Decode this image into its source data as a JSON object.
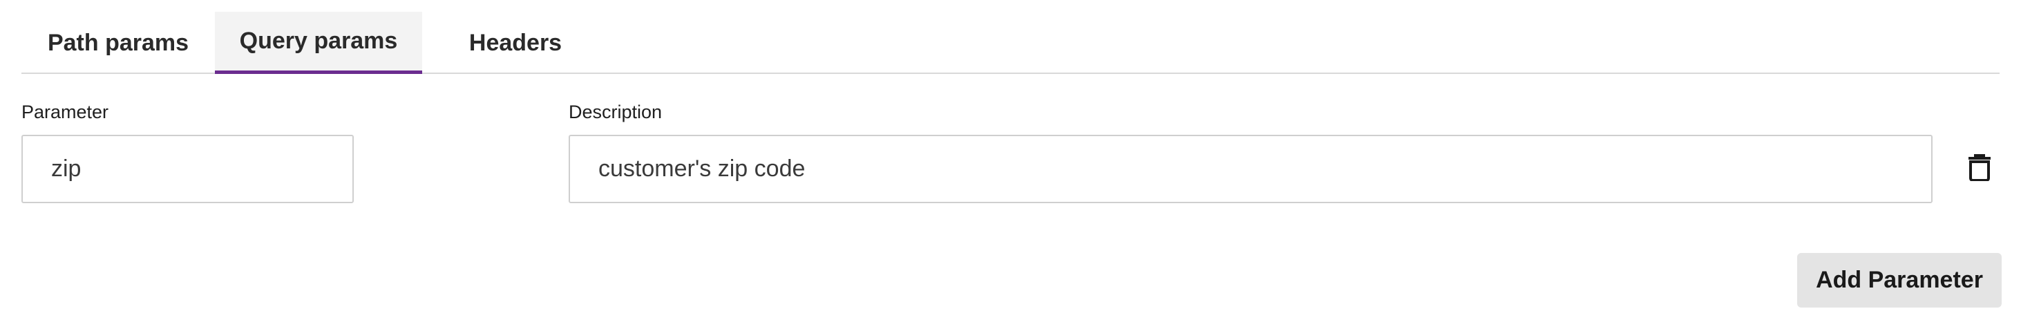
{
  "tabs": [
    {
      "label": "Path params",
      "active": false
    },
    {
      "label": "Query params",
      "active": true
    },
    {
      "label": "Headers",
      "active": false
    }
  ],
  "colors": {
    "active_tab_underline": "#6b2d8f",
    "active_tab_background": "#f3f3f3",
    "button_background": "#e4e4e4"
  },
  "row": {
    "parameter_label": "Parameter",
    "parameter_value": "zip",
    "description_label": "Description",
    "description_value": "customer's zip code",
    "delete_icon": "trash-icon"
  },
  "actions": {
    "add_label": "Add Parameter"
  }
}
